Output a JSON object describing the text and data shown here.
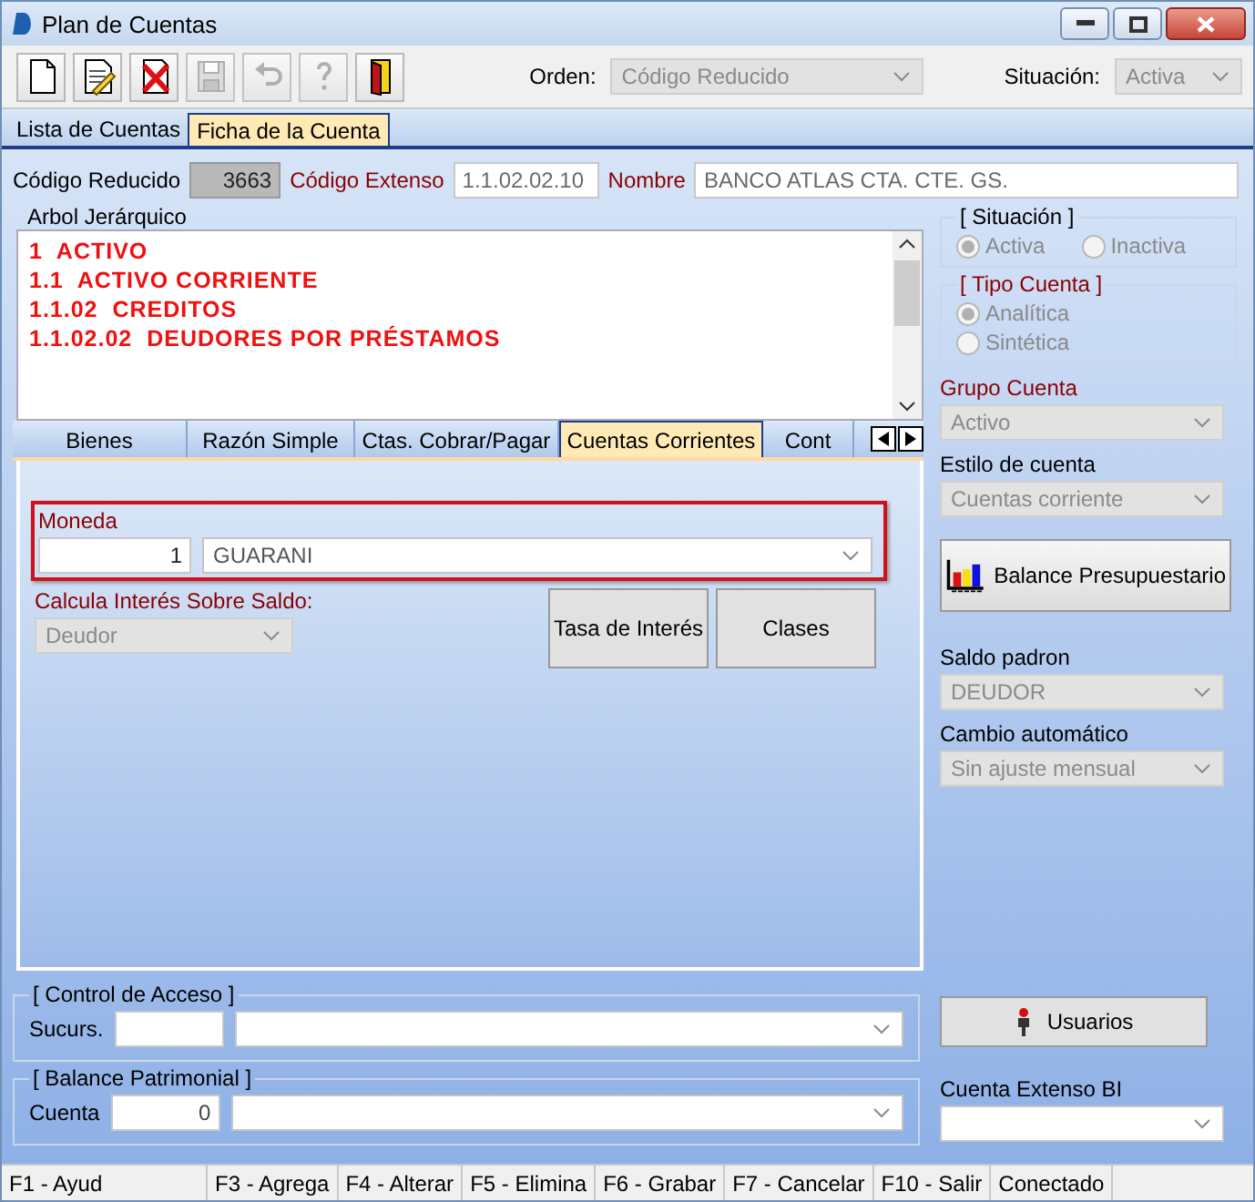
{
  "window": {
    "title": "Plan de Cuentas"
  },
  "toolbar": {
    "buttons": [
      {
        "kind": "new",
        "disabled": false
      },
      {
        "kind": "edit",
        "disabled": false
      },
      {
        "kind": "delete",
        "disabled": false
      },
      {
        "kind": "save",
        "disabled": true
      },
      {
        "kind": "undo",
        "disabled": true
      },
      {
        "kind": "help",
        "disabled": true
      },
      {
        "kind": "exit",
        "disabled": false
      }
    ],
    "orden": {
      "label": "Orden:",
      "value": "Código Reducido",
      "disabled": true
    },
    "situacion": {
      "label": "Situación:",
      "value": "Activa",
      "disabled": true
    }
  },
  "tabs": [
    {
      "label": "Lista de Cuentas",
      "selected": false
    },
    {
      "label": "Ficha de la Cuenta",
      "selected": true
    }
  ],
  "header_fields": [
    {
      "label": "Código Reducido",
      "value": "3663",
      "required": false,
      "readonly": true
    },
    {
      "label": "Código Extenso",
      "value": "1.1.02.02.10",
      "required": true,
      "readonly": false
    },
    {
      "label": "Nombre",
      "value": "BANCO ATLAS CTA. CTE. GS.",
      "required": true,
      "readonly": false
    }
  ],
  "tree": {
    "label": "Arbol Jerárquico",
    "lines": [
      "1  ACTIVO",
      "1.1  ACTIVO CORRIENTE",
      "1.1.02  CREDITOS",
      "1.1.02.02  DEUDORES POR PRÉSTAMOS"
    ]
  },
  "subtabs": [
    {
      "label": "Bienes",
      "selected": false
    },
    {
      "label": "Razón Simple",
      "selected": false
    },
    {
      "label": "Ctas. Cobrar/Pagar",
      "selected": false
    },
    {
      "label": "Cuentas Corrientes",
      "selected": true
    },
    {
      "label": "Cont",
      "selected": false
    }
  ],
  "cuentas_corrientes": {
    "moneda": {
      "label": "Moneda",
      "code": "1",
      "value": "GUARANI",
      "highlighted": true
    },
    "calcula": {
      "label": "Calcula Interés Sobre Saldo:",
      "value": "Deudor",
      "disabled": true
    },
    "buttons": [
      "Tasa de Interés",
      "Clases"
    ]
  },
  "situacion_group": {
    "title": "[ Situación ]",
    "disabled": true,
    "options": [
      {
        "label": "Activa",
        "selected": true
      },
      {
        "label": "Inactiva",
        "selected": false
      }
    ]
  },
  "tipo_cuenta": {
    "title": "[ Tipo Cuenta ]",
    "required": true,
    "disabled": true,
    "options": [
      {
        "label": "Analítica",
        "selected": true
      },
      {
        "label": "Sintética",
        "selected": false
      }
    ]
  },
  "right_fields": [
    {
      "kind": "select",
      "label": "Grupo Cuenta",
      "value": "Activo",
      "required": true,
      "disabled": true
    },
    {
      "kind": "select",
      "label": "Estilo de cuenta",
      "value": "Cuentas corriente",
      "required": false,
      "disabled": true
    },
    {
      "kind": "button",
      "label": "Balance Presupuestario"
    },
    {
      "kind": "select",
      "label": "Saldo padron",
      "value": "DEUDOR",
      "required": false,
      "disabled": true
    },
    {
      "kind": "select",
      "label": "Cambio automático",
      "value": "Sin ajuste mensual",
      "required": false,
      "disabled": true
    }
  ],
  "control_acceso": {
    "title": "[ Control de Acceso ]",
    "label": "Sucurs."
  },
  "usuarios_button": {
    "label": "Usuarios"
  },
  "balance_patrimonial": {
    "title": "[ Balance Patrimonial ]",
    "label": "Cuenta",
    "code": "0"
  },
  "cuenta_extenso_bi": {
    "label": "Cuenta Extenso BI"
  },
  "status_bar": [
    "F1 - Ayud",
    "F3 - Agrega",
    "F4 - Alterar",
    "F5 - Elimina",
    "F6 - Grabar",
    "F7 - Cancelar",
    "F10 - Salir",
    "Conectado"
  ]
}
